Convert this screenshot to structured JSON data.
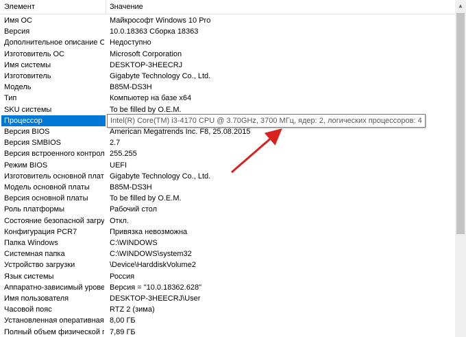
{
  "columns": {
    "element": "Элемент",
    "value": "Значение"
  },
  "rows": [
    {
      "label": "Имя ОС",
      "value": "Майкрософт Windows 10 Pro"
    },
    {
      "label": "Версия",
      "value": "10.0.18363 Сборка 18363"
    },
    {
      "label": "Дополнительное описание ОС",
      "value": "Недоступно"
    },
    {
      "label": "Изготовитель ОС",
      "value": "Microsoft Corporation"
    },
    {
      "label": "Имя системы",
      "value": "DESKTOP-3HEECRJ"
    },
    {
      "label": "Изготовитель",
      "value": "Gigabyte Technology Co., Ltd."
    },
    {
      "label": "Модель",
      "value": "B85M-DS3H"
    },
    {
      "label": "Тип",
      "value": "Компьютер на базе x64"
    },
    {
      "label": "SKU системы",
      "value": "To be filled by O.E.M."
    },
    {
      "label": "Процессор",
      "value": ""
    },
    {
      "label": "Версия BIOS",
      "value": "American Megatrends Inc. F8, 25.08.2015"
    },
    {
      "label": "Версия SMBIOS",
      "value": "2.7"
    },
    {
      "label": "Версия встроенного контролл...",
      "value": "255.255"
    },
    {
      "label": "Режим BIOS",
      "value": "UEFI"
    },
    {
      "label": "Изготовитель основной платы",
      "value": "Gigabyte Technology Co., Ltd."
    },
    {
      "label": "Модель основной платы",
      "value": "B85M-DS3H"
    },
    {
      "label": "Версия основной платы",
      "value": "To be filled by O.E.M."
    },
    {
      "label": "Роль платформы",
      "value": "Рабочий стол"
    },
    {
      "label": "Состояние безопасной загруз...",
      "value": "Откл."
    },
    {
      "label": "Конфигурация PCR7",
      "value": "Привязка невозможна"
    },
    {
      "label": "Папка Windows",
      "value": "C:\\WINDOWS"
    },
    {
      "label": "Системная папка",
      "value": "C:\\WINDOWS\\system32"
    },
    {
      "label": "Устройство загрузки",
      "value": "\\Device\\HarddiskVolume2"
    },
    {
      "label": "Язык системы",
      "value": "Россия"
    },
    {
      "label": "Аппаратно-зависимый уровен...",
      "value": "Версия = \"10.0.18362.628\""
    },
    {
      "label": "Имя пользователя",
      "value": "DESKTOP-3HEECRJ\\User"
    },
    {
      "label": "Часовой пояс",
      "value": "RTZ 2 (зима)"
    },
    {
      "label": "Установленная оперативная п...",
      "value": "8,00 ГБ"
    },
    {
      "label": "Полный объем физической па...",
      "value": "7,89 ГБ"
    }
  ],
  "tooltip": "Intel(R) Core(TM) i3-4170 CPU @ 3.70GHz, 3700 МГц, ядер: 2, логических процессоров: 4",
  "colors": {
    "selection": "#0078d7",
    "arrow": "#d9201f"
  },
  "icons": {
    "scroll_up": "chevron-up-icon"
  }
}
